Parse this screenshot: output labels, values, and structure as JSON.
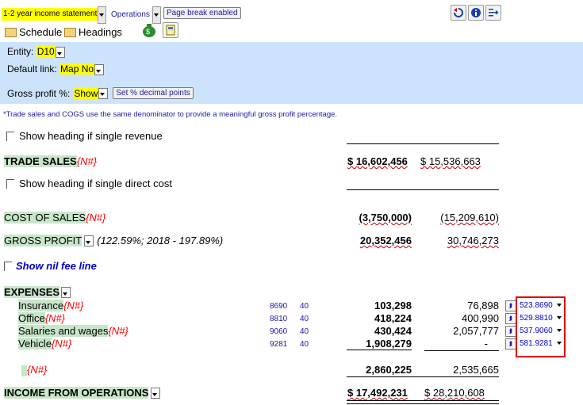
{
  "toolbar": {
    "statement_select": "1-2 year income statement",
    "operations": "Operations",
    "page_break": "Page break enabled",
    "schedule": "Schedule",
    "headings": "Headings"
  },
  "panel": {
    "entity_label": "Entity:",
    "entity_value": "D10",
    "default_link_label": "Default link:",
    "default_link_value": "Map No",
    "gross_profit_label": "Gross profit %:",
    "gross_profit_value": "Show",
    "set_decimal_btn": "Set % decimal points"
  },
  "note": "*Trade sales and COGS use the same denominator to provide a meaningful gross profit percentage.",
  "rows": {
    "show_heading_revenue": "Show heading if single revenue",
    "trade_sales": "TRADE SALES",
    "nh_tag": "{N#}",
    "trade_sales_cur": "$ 16,602,456",
    "trade_sales_prior": "$ 15,536,663",
    "show_heading_cost": "Show heading if single direct cost",
    "cost_of_sales": "COST OF SALES",
    "cost_cur": "(3,750,000)",
    "cost_prior": "(15,209,610)",
    "gross_profit": "GROSS PROFIT",
    "gross_profit_pct": "(122.59%; 2018 - 197.89%)",
    "gross_cur": "20,352,456",
    "gross_prior": "30,746,273",
    "show_nil_fee": "Show nil fee line",
    "expenses": "EXPENSES",
    "expense_items": [
      {
        "label": "Insurance",
        "code": "8690",
        "col": "40",
        "cur": "103,298",
        "prior": "76,898",
        "map": "523.8690"
      },
      {
        "label": "Office",
        "code": "8810",
        "col": "40",
        "cur": "418,224",
        "prior": "400,990",
        "map": "529.8810"
      },
      {
        "label": "Salaries and wages",
        "code": "9060",
        "col": "40",
        "cur": "430,424",
        "prior": "2,057,777",
        "map": "537.9060"
      },
      {
        "label": "Vehicle",
        "code": "9281",
        "col": "40",
        "cur": "1,908,279",
        "prior": "-",
        "map": "581.9281"
      }
    ],
    "expenses_total_cur": "2,860,225",
    "expenses_total_prior": "2,535,665",
    "income_ops": "INCOME FROM OPERATIONS",
    "income_cur": "$ 17,492,231",
    "income_prior": "$ 28,210,608"
  },
  "colors": {
    "yellow": "#ffff00",
    "panel_blue": "#cce3fb",
    "green_highlight": "#c8e6c9",
    "red_tag": "#ff0000",
    "map_box": "#e00000"
  }
}
